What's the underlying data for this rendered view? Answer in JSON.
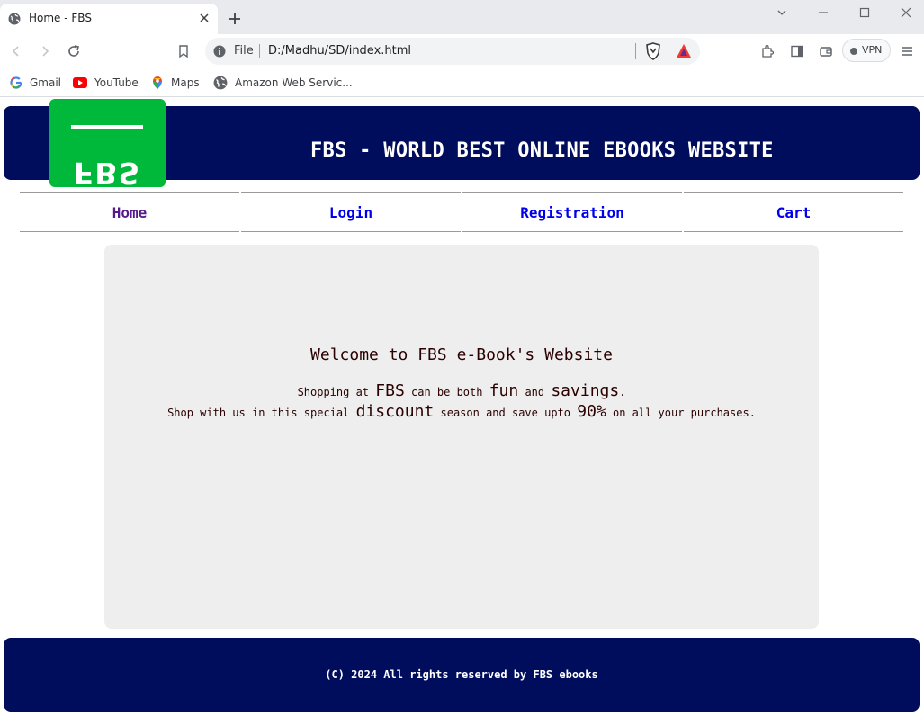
{
  "browser": {
    "tab_title": "Home - FBS",
    "address_scheme_label": "File",
    "address_url": "D:/Madhu/SD/index.html",
    "vpn_label": "VPN",
    "bookmarks": [
      {
        "label": "Gmail",
        "icon": "gmail-icon"
      },
      {
        "label": "YouTube",
        "icon": "youtube-icon"
      },
      {
        "label": "Maps",
        "icon": "maps-icon"
      },
      {
        "label": "Amazon Web Servic...",
        "icon": "globe-icon"
      }
    ]
  },
  "site": {
    "logo_text": "FBS",
    "header_title": "FBS - WORLD BEST ONLINE EBOOKS WEBSITE",
    "nav": [
      {
        "label": "Home",
        "state": "visited",
        "color": "#551a8b"
      },
      {
        "label": "Login",
        "state": "link",
        "color": "#0000ee"
      },
      {
        "label": "Registration",
        "state": "link",
        "color": "#0000ee"
      },
      {
        "label": "Cart",
        "state": "link",
        "color": "#0000ee"
      }
    ],
    "welcome_heading": "Welcome to FBS e-Book's Website",
    "line1": {
      "a": "Shopping at ",
      "b": "FBS",
      "c": " can be both ",
      "d": "fun",
      "e": " and ",
      "f": "savings",
      "g": "."
    },
    "line2": {
      "a": "Shop with us in this special ",
      "b": "discount",
      "c": " season and save upto ",
      "d": "90%",
      "e": " on all your purchases."
    },
    "footer_text": "(C) 2024 All rights reserved by FBS ebooks",
    "colors": {
      "header_bg": "#000c5c",
      "logo_bg": "#00b93a",
      "content_bg": "#eeeeee",
      "content_text": "#2a0000"
    }
  }
}
